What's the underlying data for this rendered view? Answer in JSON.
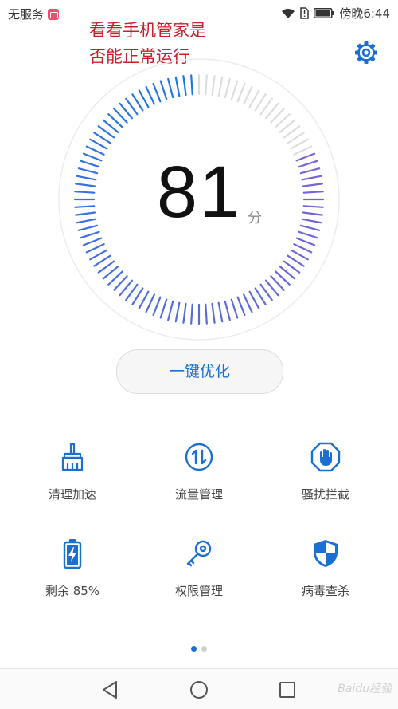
{
  "status_bar": {
    "carrier": "无服务",
    "time": "傍晚6:44"
  },
  "annotation": {
    "line1": "看看手机管家是",
    "line2": "否能正常运行"
  },
  "gauge": {
    "score": "81",
    "unit": "分",
    "fill_fraction": 0.81
  },
  "optimize_button": "一键优化",
  "features": [
    {
      "label": "清理加速",
      "icon": "broom-icon"
    },
    {
      "label": "流量管理",
      "icon": "data-arrows-icon"
    },
    {
      "label": "骚扰拦截",
      "icon": "hand-stop-icon"
    },
    {
      "label": "剩余 85%",
      "icon": "battery-icon"
    },
    {
      "label": "权限管理",
      "icon": "key-icon"
    },
    {
      "label": "病毒查杀",
      "icon": "shield-icon"
    }
  ],
  "pagination": {
    "current": 1,
    "total": 2
  },
  "navigation": {
    "back": "back-icon",
    "home": "home-icon",
    "recents": "recents-icon"
  },
  "watermark": "Baidu经验",
  "colors": {
    "accent": "#1a6fd0",
    "annotation": "#c8202a",
    "gauge_start": "#7a63d8",
    "gauge_end": "#1e78e0",
    "gauge_track": "#dddddd"
  }
}
